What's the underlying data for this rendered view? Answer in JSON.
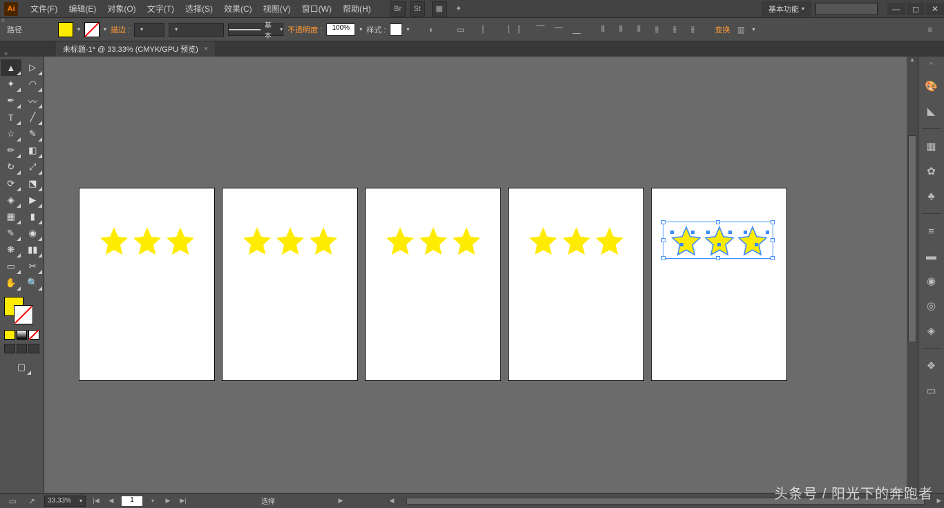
{
  "app": {
    "logo": "Ai"
  },
  "menu": {
    "file": "文件(F)",
    "edit": "编辑(E)",
    "object": "对象(O)",
    "type": "文字(T)",
    "select": "选择(S)",
    "effect": "效果(C)",
    "view": "视图(V)",
    "window": "窗口(W)",
    "help": "帮助(H)"
  },
  "workspace_switcher": "基本功能",
  "search_placeholder": "",
  "control": {
    "object_type": "路径",
    "stroke_label": "描边 :",
    "stroke_weight": "",
    "brush_def": "基本",
    "opacity_label": "不透明度 :",
    "opacity_value": "100%",
    "style_label": "样式 :",
    "transform_label": "变换"
  },
  "document": {
    "tab_title": "未标题-1* @ 33.33% (CMYK/GPU 预览)"
  },
  "colors": {
    "fill": "#ffeb00",
    "stroke": "none",
    "accent": "#ff9933",
    "selection": "#3b8cff"
  },
  "artboards": {
    "count": 5,
    "selected_index": 5
  },
  "status": {
    "zoom": "33.33%",
    "artboard_current": "1",
    "tool_hint": "选择"
  },
  "watermark": "头条号 / 阳光下的奔跑者"
}
